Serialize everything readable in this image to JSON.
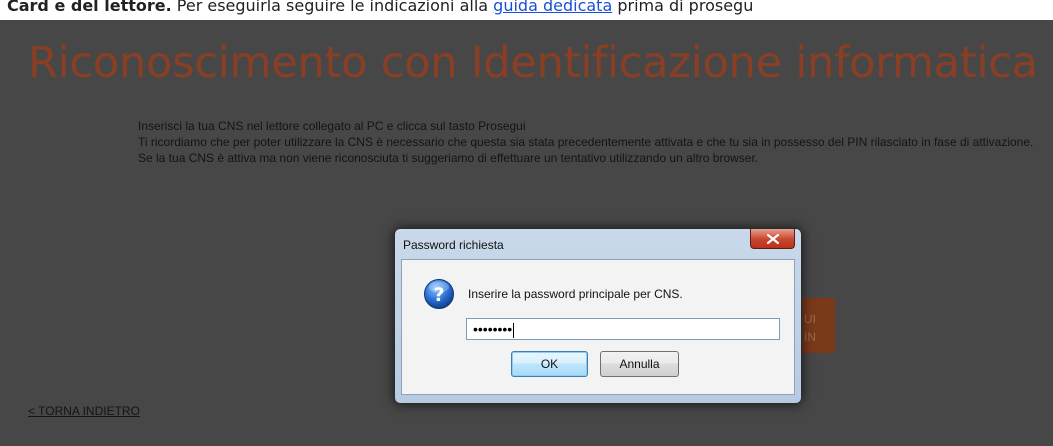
{
  "top_notice": {
    "bold_text": "Card e del lettore.",
    "text_before_link": " Per eseguirla seguire le indicazioni alla ",
    "link_text": "guida dedicata",
    "text_after_link": " prima di prosegu"
  },
  "page": {
    "title": "Riconoscimento con Identificazione informatica",
    "instructions_line1": "Inserisci la tua CNS nel lettore collegato al PC e clicca sul tasto Prosegui",
    "instructions_line2": "Ti ricordiamo che per poter utilizzare la CNS è necessario che questa sia stata precedentemente attivata e che tu sia in possesso del PIN rilasciato in fase di attivazione. Se la tua CNS è attiva ma non viene riconosciuta ti suggeriamo di effettuare un tentativo utilizzando un altro browser.",
    "proceed_button_partial": "UI\nIN",
    "back_link": "< TORNA INDIETRO"
  },
  "dialog": {
    "title": "Password richiesta",
    "prompt": "Inserire la password principale per CNS.",
    "password_value": "••••••••",
    "ok_label": "OK",
    "cancel_label": "Annulla",
    "icon": "question-icon",
    "close_icon": "close-icon"
  },
  "colors": {
    "page_background": "#474747",
    "title_color": "#8a3f24",
    "link_color": "#1a4fd6",
    "proceed_button": "#7a3a1a",
    "close_button": "#c7452c"
  }
}
